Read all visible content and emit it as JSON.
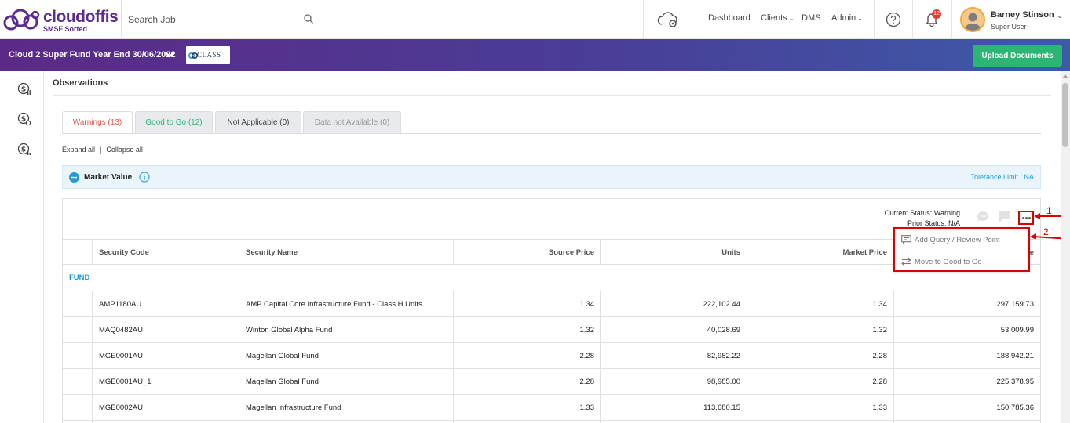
{
  "header": {
    "logo_text": "cloudoffis",
    "logo_sub": "SMSF Sorted",
    "search_placeholder": "Search Job",
    "nav": {
      "dashboard": "Dashboard",
      "clients": "Clients",
      "dms": "DMS",
      "admin": "Admin"
    },
    "notification_count": "12",
    "user_name": "Barney Stinson",
    "user_role": "Super User"
  },
  "subbar": {
    "fund_selector": "Cloud 2 Super Fund Year End 30/06/2022",
    "class_logo_text": "CLASS",
    "upload_label": "Upload Documents"
  },
  "page": {
    "title": "Observations",
    "tabs": [
      {
        "label": "Warnings (13)"
      },
      {
        "label": "Good to Go (12)"
      },
      {
        "label": "Not Applicable (0)"
      },
      {
        "label": "Data not Available (0)"
      }
    ],
    "expand_all": "Expand all",
    "collapse_all": "Collapse all",
    "separator": "|"
  },
  "section": {
    "title": "Market Value",
    "tolerance": "Tolerance Limit : NA",
    "current_status": "Current Status: Warning",
    "prior_status": "Prior Status: N/A"
  },
  "table": {
    "headers": {
      "security_code": "Security Code",
      "security_name": "Security Name",
      "source_price": "Source Price",
      "units": "Units",
      "market_price": "Market Price",
      "last_partial": "e"
    },
    "group_label": "FUND",
    "rows": [
      {
        "code": "AMP1180AU",
        "name": "AMP Capital Core Infrastructure Fund - Class H Units",
        "source_price": "1.34",
        "units": "222,102.44",
        "market_price": "1.34",
        "market_value": "297,159.73"
      },
      {
        "code": "MAQ0482AU",
        "name": "Winton Global Alpha Fund",
        "source_price": "1.32",
        "units": "40,028.69",
        "market_price": "1.32",
        "market_value": "53,009.99"
      },
      {
        "code": "MGE0001AU",
        "name": "Magellan Global Fund",
        "source_price": "2.28",
        "units": "82,982.22",
        "market_price": "2.28",
        "market_value": "188,942.21"
      },
      {
        "code": "MGE0001AU_1",
        "name": "Magellan Global Fund",
        "source_price": "2.28",
        "units": "98,985.00",
        "market_price": "2.28",
        "market_value": "225,378.95"
      },
      {
        "code": "MGE0002AU",
        "name": "Magellan Infrastructure Fund",
        "source_price": "1.33",
        "units": "113,680.15",
        "market_price": "1.33",
        "market_value": "150,785.36"
      }
    ]
  },
  "menu": {
    "add_query": "Add Query / Review Point",
    "move_good": "Move to Good to Go"
  },
  "annotations": {
    "one": "1",
    "two": "2"
  },
  "colors": {
    "brand": "#5c2d91",
    "upload": "#2bb673",
    "accent_blue": "#1f9ad6",
    "warning_red": "#e05a4e",
    "annotation": "#dd0000"
  }
}
